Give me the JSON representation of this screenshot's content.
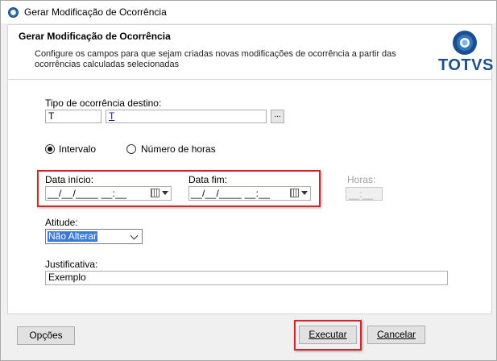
{
  "window": {
    "title": "Gerar Modificação de Ocorrência"
  },
  "header": {
    "title": "Gerar Modificação de Ocorrência",
    "description": "Configure os campos para que sejam criadas novas modificações de ocorrência a partir das ocorrências calculadas selecionadas",
    "logo_text": "TOTVS"
  },
  "form": {
    "tipo_ocorrencia": {
      "label": "Tipo de ocorrência destino:",
      "code": "T",
      "description": "T",
      "lookup_label": "..."
    },
    "radio_intervalo": {
      "label": "Intervalo",
      "selected": true
    },
    "radio_numero_horas": {
      "label": "Número de horas",
      "selected": false
    },
    "data_inicio": {
      "label": "Data início:",
      "value": "__/__/____ __:__"
    },
    "data_fim": {
      "label": "Data fim:",
      "value": "__/__/____ __:__"
    },
    "horas": {
      "label": "Horas:",
      "value": "__:__"
    },
    "atitude": {
      "label": "Atitude:",
      "selected": "Não Alterar"
    },
    "justificativa": {
      "label": "Justificativa:",
      "value": "Exemplo"
    }
  },
  "buttons": {
    "opcoes": "Opções",
    "executar": "Executar",
    "cancelar": "Cancelar"
  },
  "colors": {
    "highlight": "#d9232a",
    "brand": "#1c4f8b",
    "selection": "#3b78d8"
  }
}
